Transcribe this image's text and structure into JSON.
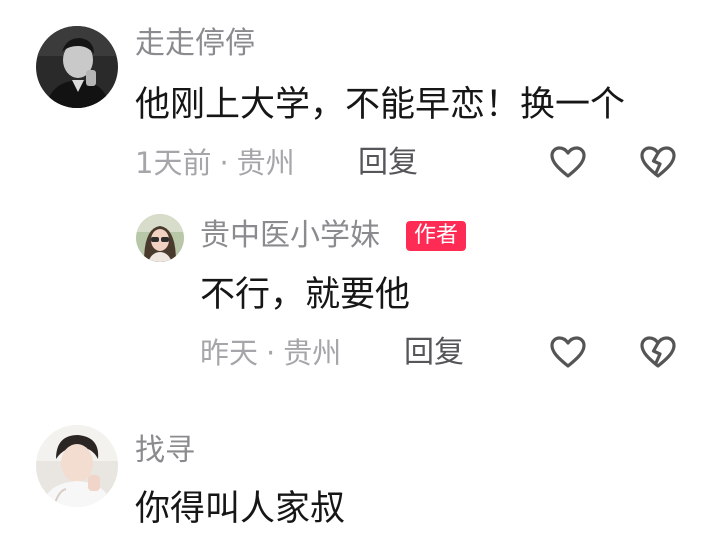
{
  "comments": [
    {
      "username": "走走停停",
      "content": "他刚上大学，不能早恋！换一个",
      "time": "1天前",
      "location": "贵州",
      "reply_label": "回复",
      "avatar_icon": "avatar-man-monochrome"
    },
    {
      "username": "贵中医小学妹",
      "badge": "作者",
      "content": "不行，就要他",
      "time": "昨天",
      "location": "贵州",
      "reply_label": "回复",
      "avatar_icon": "avatar-girl-photo"
    },
    {
      "username": "找寻",
      "content": "你得叫人家叔",
      "avatar_icon": "avatar-boy-photo"
    }
  ],
  "meta_separator": "·",
  "icons": {
    "like": "heart-outline-icon",
    "dislike": "broken-heart-outline-icon"
  },
  "colors": {
    "badge": "#fe2c55",
    "username": "#8b8b8f",
    "meta": "#a6a6aa",
    "icon": "#555555"
  }
}
